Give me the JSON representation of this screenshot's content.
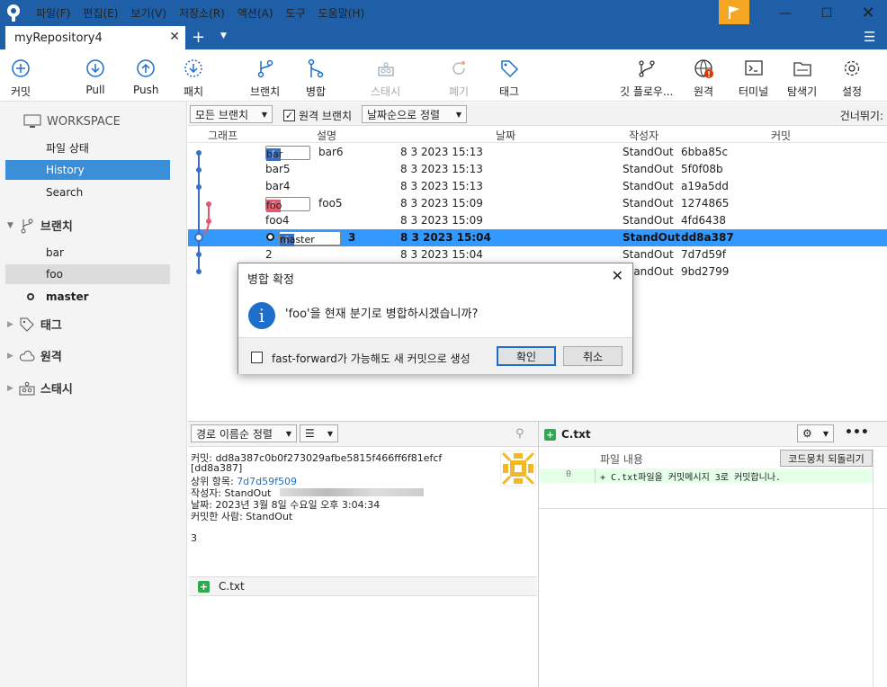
{
  "titlebar": {
    "menus": [
      "파일(F)",
      "편집(E)",
      "보기(V)",
      "저장소(R)",
      "액션(A)",
      "도구",
      "도움말(H)"
    ],
    "flag_icon": "flag-icon"
  },
  "tab": {
    "title": "myRepository4"
  },
  "toolbar": {
    "commit": "커밋",
    "pull": "Pull",
    "push": "Push",
    "patch": "패치",
    "branch": "브랜치",
    "merge": "병합",
    "stash": "스태시",
    "discard": "폐기",
    "tag": "태그",
    "gitflow": "깃 플로우...",
    "remote": "원격",
    "terminal": "터미널",
    "explorer": "탐색기",
    "settings": "설정"
  },
  "sidebar": {
    "workspace": "WORKSPACE",
    "file_status": "파일 상태",
    "history": "History",
    "search": "Search",
    "branches": "브랜치",
    "branch_items": [
      "bar",
      "foo",
      "master"
    ],
    "tags": "태그",
    "remotes": "원격",
    "stashes": "스태시"
  },
  "filter": {
    "all_branches": "모든 브랜치",
    "remote_branches": "원격 브랜치",
    "sort": "날짜순으로 정렬",
    "jump": "건너뛰기:"
  },
  "columns": {
    "graph": "그래프",
    "desc": "설명",
    "date": "날짜",
    "author": "작성자",
    "commit": "커밋"
  },
  "commits": [
    {
      "ref": "bar",
      "desc": "bar6",
      "date": "8 3 2023 15:13",
      "author": "StandOut",
      "hash": "6bba85c"
    },
    {
      "ref": "",
      "desc": "bar5",
      "date": "8 3 2023 15:13",
      "author": "StandOut",
      "hash": "5f0f08b"
    },
    {
      "ref": "",
      "desc": "bar4",
      "date": "8 3 2023 15:13",
      "author": "StandOut",
      "hash": "a19a5dd"
    },
    {
      "ref": "foo",
      "desc": "foo5",
      "date": "8 3 2023 15:09",
      "author": "StandOut",
      "hash": "1274865"
    },
    {
      "ref": "",
      "desc": "foo4",
      "date": "8 3 2023 15:09",
      "author": "StandOut",
      "hash": "4fd6438"
    },
    {
      "ref": "master",
      "desc": "3",
      "date": "8 3 2023 15:04",
      "author": "StandOut",
      "hash": "dd8a387"
    },
    {
      "ref": "",
      "desc": "2",
      "date": "8 3 2023 15:04",
      "author": "StandOut",
      "hash": "7d7d59f"
    },
    {
      "ref": "",
      "desc": "",
      "date": "",
      "author": "StandOut",
      "hash": "9bd2799"
    }
  ],
  "dialog": {
    "title": "병합 확정",
    "message": "'foo'을 현재 분기로 병합하시겠습니까?",
    "checkbox": "fast-forward가 가능해도 새 커밋으로 생성",
    "ok": "확인",
    "cancel": "취소"
  },
  "details": {
    "sort": "경로 이름순 정렬",
    "commit_line": "커밋: dd8a387c0b0f273029afbe5815f466ff6f81efcf",
    "short_hash": "[dd8a387]",
    "parent_label": "상위 항목:",
    "parent": "7d7d59f509",
    "author_line": "작성자: StandOut",
    "date_line": "날짜: 2023년 3월 8일 수요일 오후 3:04:34",
    "committer_line": "커밋한 사람: StandOut",
    "message": "3",
    "file": "C.txt"
  },
  "diff": {
    "file": "C.txt",
    "content_label": "파일 내용",
    "revert": "코드뭉치 되돌리기",
    "line_no": "0",
    "line": "+ C.txt파일을 커밋메시지 3로 커밋합니나."
  }
}
